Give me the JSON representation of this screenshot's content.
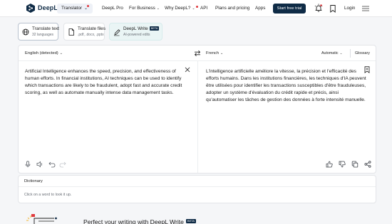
{
  "header": {
    "logo_text": "DeepL",
    "translator_label": "Translator",
    "nav": {
      "deepl_pro": "DeepL Pro",
      "for_business": "For Business",
      "why_deepl": "Why DeepL?",
      "api": "API",
      "plans": "Plans and pricing",
      "apps": "Apps"
    },
    "trial_button": "Start free trial",
    "login": "Login"
  },
  "modes": [
    {
      "title": "Translate text",
      "subtitle": "32 languages"
    },
    {
      "title": "Translate files",
      "subtitle": ".pdf, .docx, .pptx"
    },
    {
      "title": "DeepL Write",
      "badge": "BETA",
      "subtitle": "AI-powered edits"
    }
  ],
  "translator": {
    "source_lang": "English (detected)",
    "target_lang": "French",
    "formality": "Automatic",
    "glossary": "Glossary",
    "source_text": "Artificial Intelligence enhances the speed, precision, and effectiveness of human efforts. In financial institutions, AI techniques can be used to identify which transactions are likely to be fraudulent, adopt fast and accurate credit scoring, as well as automate manually intense data management tasks.",
    "target_text": "L'intelligence artificielle améliore la vitesse, la précision et l'efficacité des efforts humains. Dans les institutions financières, les techniques d'IA peuvent être utilisées pour identifier les transactions susceptibles d'être frauduleuses, adopter un système d'évaluation du crédit rapide et précis, ainsi qu'automatiser les tâches de gestion des données à forte intensité manuelle."
  },
  "dictionary": {
    "title": "Dictionary",
    "hint": "Click on a word to look it up."
  },
  "promo": {
    "text": "Perfect your writing with DeepL Write",
    "badge": "BETA"
  },
  "colors": {
    "brand_navy": "#0f2b46",
    "notification_red": "#e0393e",
    "write_tab_bg": "#eaf5f5"
  },
  "icons": [
    "deepl-logo-icon",
    "bell-icon",
    "bookmark-icon",
    "menu-icon",
    "globe-icon",
    "file-icon",
    "pen-icon",
    "swap-icon",
    "close-icon",
    "microphone-icon",
    "speaker-icon",
    "undo-icon",
    "redo-icon",
    "thumbs-up-icon",
    "thumbs-down-icon",
    "copy-icon",
    "share-icon"
  ]
}
